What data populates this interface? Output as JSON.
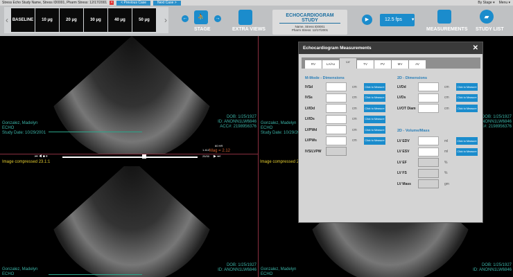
{
  "titlebar": {
    "title": "Stress Echo Study Name, Stress ID0001, Pharm Stress: 12/17/2001",
    "prev": "< Previous Case",
    "next": "Next Case >",
    "by_stage": "By Stage ▾",
    "menu": "Menu ▾"
  },
  "thumbnails": [
    "BASELINE",
    "10 μg",
    "20 μg",
    "30 μg",
    "40 μg",
    "50 μg"
  ],
  "toolbar": {
    "stage": "STAGE",
    "extra_views": "EXTRA VIEWS",
    "study_title": "ECHOCARDIOGRAM STUDY",
    "study_name": "Name, Stress ID0001",
    "study_date": "Pharm Stress: 12/17/2001",
    "fps": "12.5 fps",
    "measurements": "MEASUREMENTS",
    "study_list": "STUDY LIST"
  },
  "viewport": {
    "patient": "Gonzalez, Madelyn",
    "modality": "ECHO",
    "study_date": "Study Date: 10/29/2001",
    "dob": "DOB: 1/25/1927",
    "id": "ID: ANONN1LW6846",
    "acc": "ACC#: 2198956376",
    "mag": "Mag = 2.12",
    "compressed": "Image compressed 23.1:1",
    "frame": "25/30",
    "hr": "60 HR",
    "depth": "1.412"
  },
  "dialog": {
    "title": "Echocardiogram Measurements",
    "tabs": [
      "RV",
      "LA/Ao",
      "LV",
      "TV",
      "PV",
      "MV",
      "AV"
    ],
    "active_tab": "LV",
    "mmode_title": "M-Mode - Dimensions",
    "twod_title": "2D - Dimensions",
    "vol_title": "2D - Volume/Mass",
    "measure": "Click to Measure",
    "mmode": [
      {
        "label": "IVSd",
        "unit": "cm"
      },
      {
        "label": "IVSs",
        "unit": "cm"
      },
      {
        "label": "LVIDd",
        "unit": "cm"
      },
      {
        "label": "LVIDs",
        "unit": "cm"
      },
      {
        "label": "LVPWd",
        "unit": "cm"
      },
      {
        "label": "LVPWs",
        "unit": "cm"
      },
      {
        "label": "IVS/LVPW",
        "unit": ""
      }
    ],
    "twod": [
      {
        "label": "LVDd",
        "unit": "cm"
      },
      {
        "label": "LVDs",
        "unit": "cm"
      },
      {
        "label": "LVOT Diam",
        "unit": "cm"
      }
    ],
    "vol": [
      {
        "label": "LV EDV",
        "unit": "ml"
      },
      {
        "label": "LV ESV",
        "unit": "ml"
      },
      {
        "label": "LV EF",
        "unit": "%"
      },
      {
        "label": "LV FS",
        "unit": "%"
      },
      {
        "label": "LV Mass",
        "unit": "gm"
      }
    ]
  }
}
